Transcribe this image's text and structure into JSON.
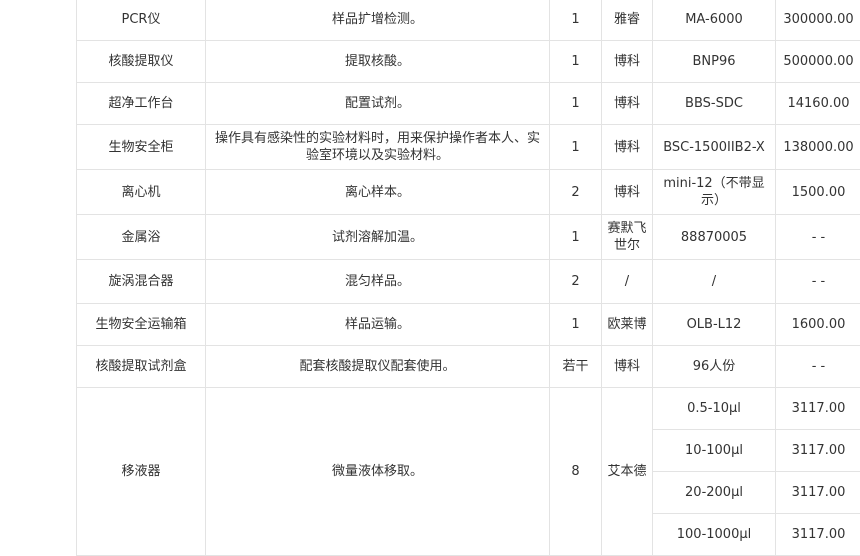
{
  "table": {
    "rows": [
      {
        "name": "PCR仪",
        "purpose": "样品扩增检测。",
        "qty": "1",
        "brand": "雅睿",
        "model": "MA-6000",
        "price": "300000.00"
      },
      {
        "name": "核酸提取仪",
        "purpose": "提取核酸。",
        "qty": "1",
        "brand": "博科",
        "model": "BNP96",
        "price": "500000.00"
      },
      {
        "name": "超净工作台",
        "purpose": "配置试剂。",
        "qty": "1",
        "brand": "博科",
        "model": "BBS-SDC",
        "price": "14160.00"
      },
      {
        "name": "生物安全柜",
        "purpose": "操作具有感染性的实验材料时，用来保护操作者本人、实验室环境以及实验材料。",
        "qty": "1",
        "brand": "博科",
        "model": "BSC-1500IIB2-X",
        "price": "138000.00"
      },
      {
        "name": "离心机",
        "purpose": "离心样本。",
        "qty": "2",
        "brand": "博科",
        "model": "mini-12（不带显示）",
        "price": "1500.00"
      },
      {
        "name": "金属浴",
        "purpose": "试剂溶解加温。",
        "qty": "1",
        "brand": "赛默飞世尔",
        "model": "88870005",
        "price": "- -"
      },
      {
        "name": "旋涡混合器",
        "purpose": "混匀样品。",
        "qty": "2",
        "brand": "/",
        "model": "/",
        "price": "- -"
      },
      {
        "name": "生物安全运输箱",
        "purpose": "样品运输。",
        "qty": "1",
        "brand": "欧莱博",
        "model": "OLB-L12",
        "price": "1600.00"
      },
      {
        "name": "核酸提取试剂盒",
        "purpose": "配套核酸提取仪配套使用。",
        "qty": "若干",
        "brand": "博科",
        "model": "96人份",
        "price": "- -"
      }
    ],
    "pipette": {
      "name": "移液器",
      "purpose": "微量液体移取。",
      "qty": "8",
      "brand": "艾本德",
      "variants": [
        {
          "model": "0.5-10μl",
          "price": "3117.00"
        },
        {
          "model": "10-100μl",
          "price": "3117.00"
        },
        {
          "model": "20-200μl",
          "price": "3117.00"
        },
        {
          "model": "100-1000μl",
          "price": "3117.00"
        }
      ]
    }
  }
}
